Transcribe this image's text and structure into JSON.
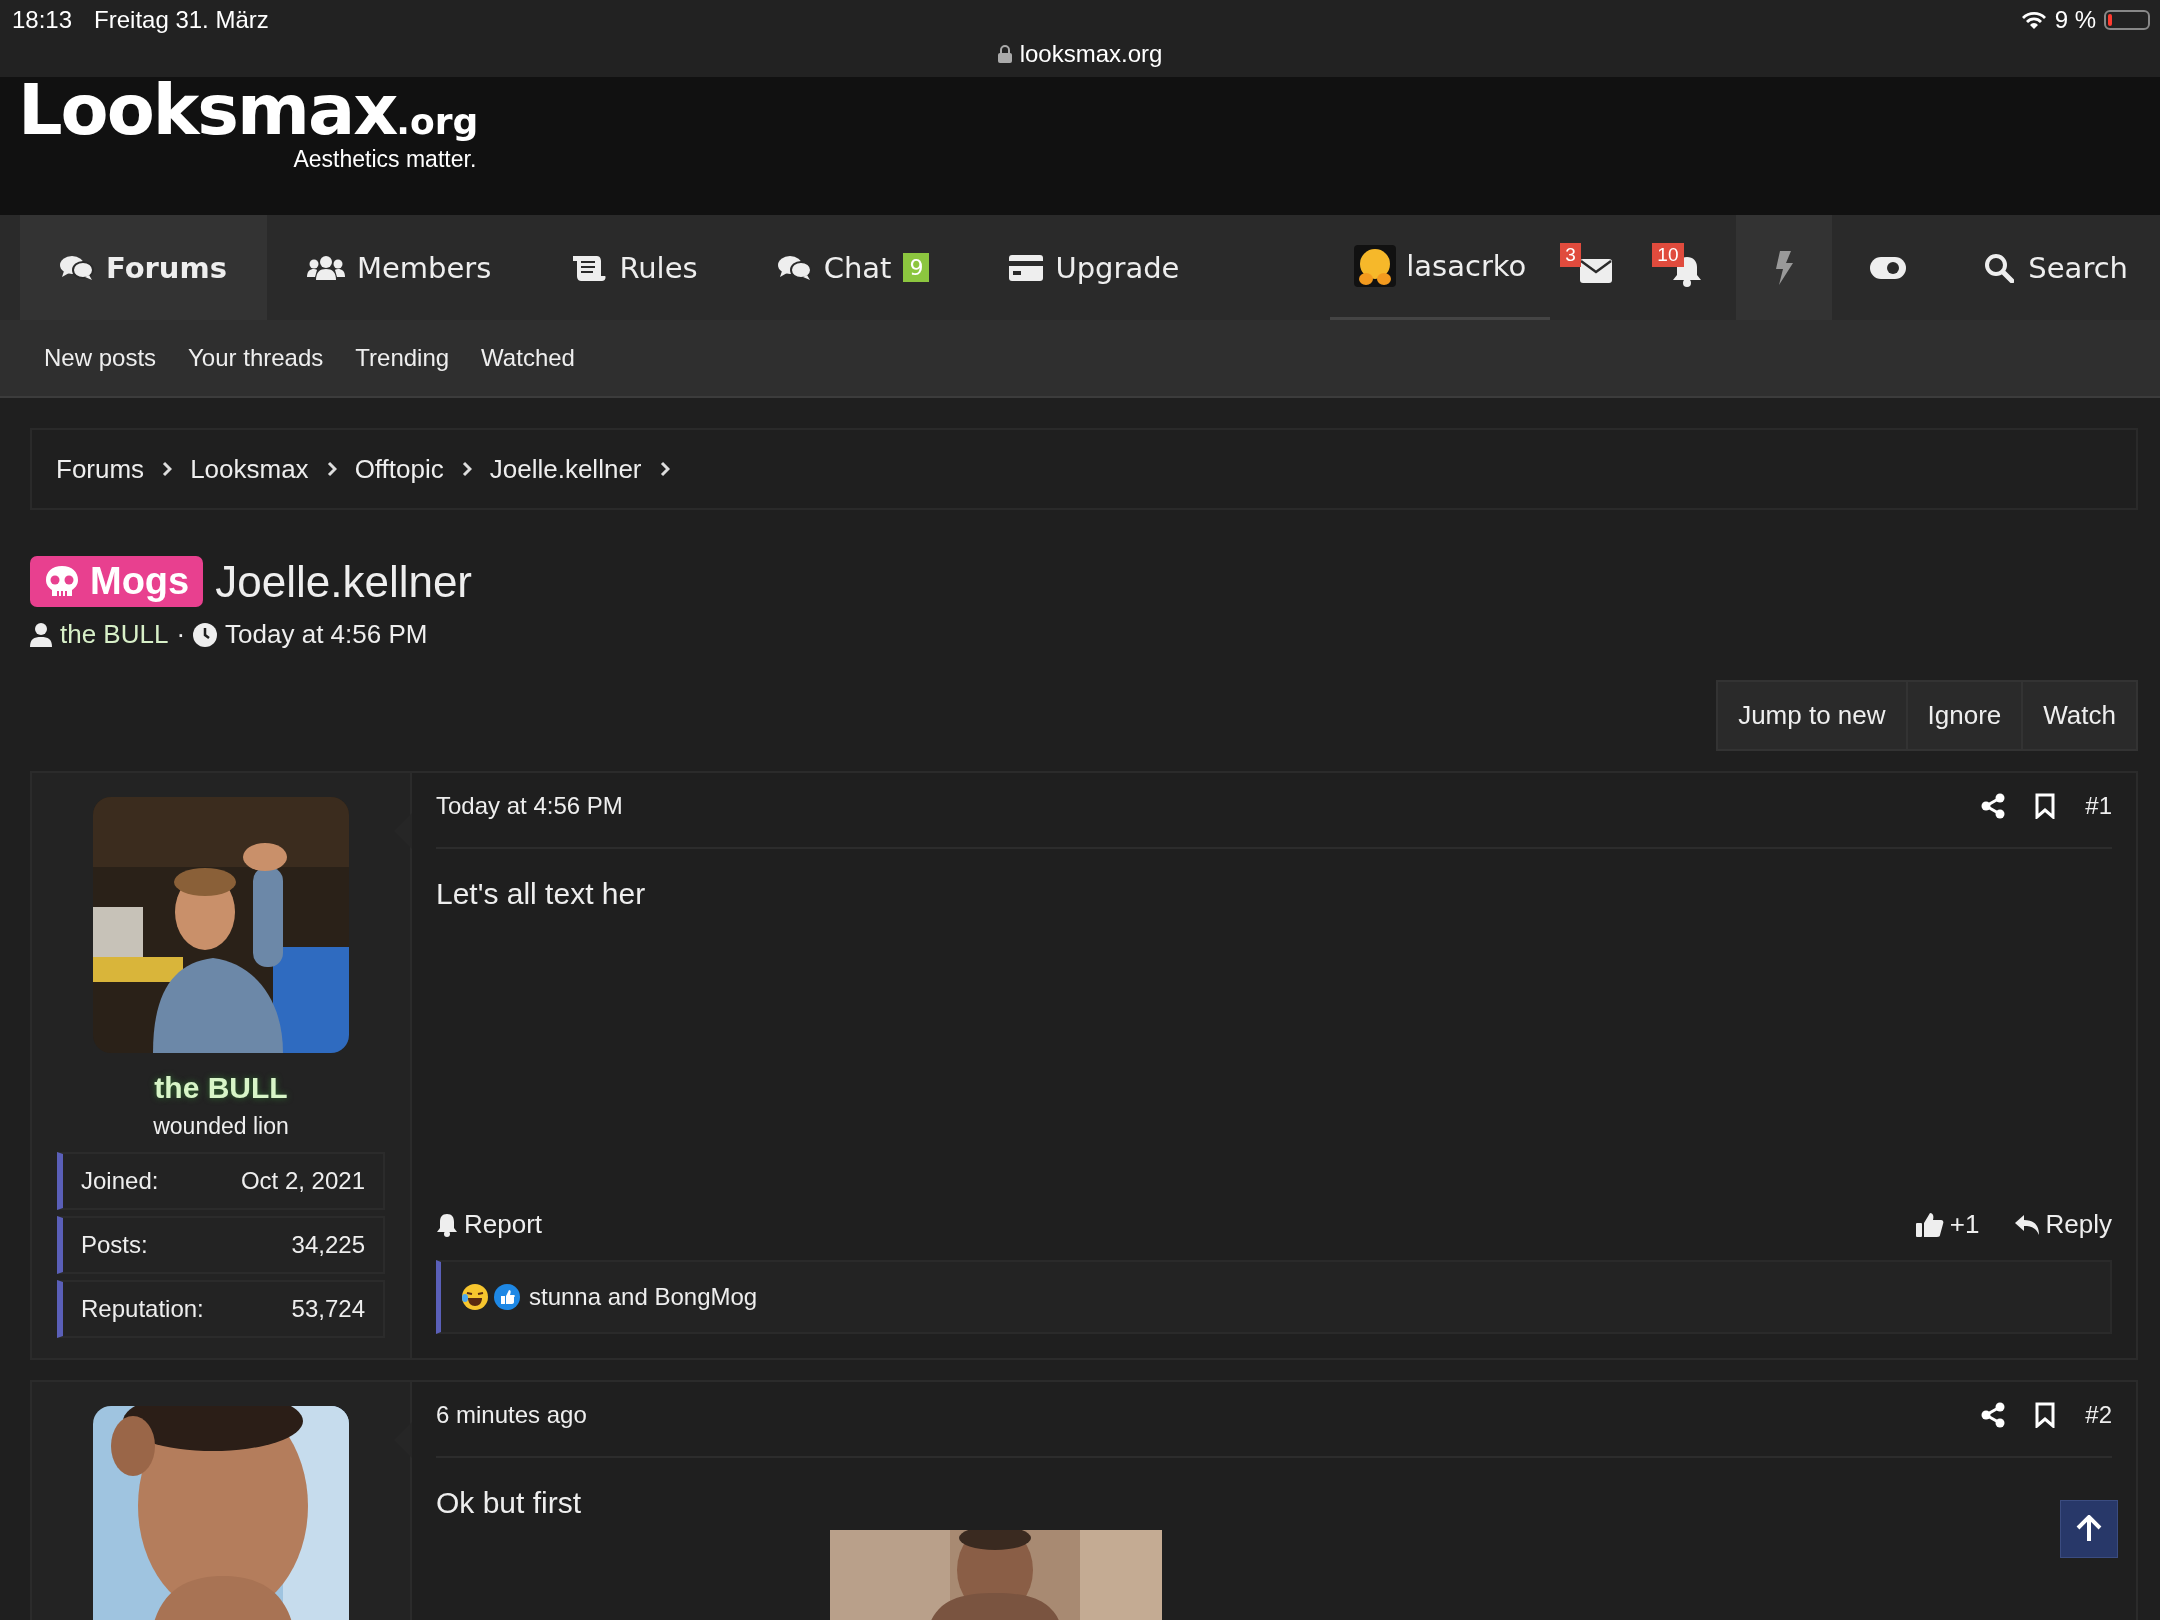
{
  "status_bar": {
    "time": "18:13",
    "date": "Freitag 31. März",
    "battery": "9 %"
  },
  "address_bar": {
    "url": "looksmax.org"
  },
  "header": {
    "logo": "Looksmax",
    "logo_suffix": ".org",
    "tagline": "Aesthetics matter."
  },
  "nav": {
    "tabs": [
      {
        "label": "Forums",
        "selected": true
      },
      {
        "label": "Members",
        "selected": false
      },
      {
        "label": "Rules",
        "selected": false
      },
      {
        "label": "Chat",
        "selected": false,
        "badge": "9"
      },
      {
        "label": "Upgrade",
        "selected": false
      }
    ],
    "user": "lasacrko",
    "messages_badge": "3",
    "alerts_badge": "10",
    "search": "Search"
  },
  "subnav": [
    "New posts",
    "Your threads",
    "Trending",
    "Watched"
  ],
  "breadcrumbs": [
    "Forums",
    "Looksmax",
    "Offtopic",
    "Joelle.kellner"
  ],
  "thread": {
    "prefix": "Mogs",
    "title": "Joelle.kellner",
    "author": "the BULL",
    "separator": "·",
    "date": "Today at 4:56 PM"
  },
  "thread_actions": [
    "Jump to new",
    "Ignore",
    "Watch"
  ],
  "posts": [
    {
      "user": "the BULL",
      "user_title": "wounded lion",
      "stats": [
        {
          "label": "Joined:",
          "value": "Oct 2, 2021"
        },
        {
          "label": "Posts:",
          "value": "34,225"
        },
        {
          "label": "Reputation:",
          "value": "53,724"
        }
      ],
      "date": "Today at 4:56 PM",
      "number": "#1",
      "body": "Let's all text her",
      "report": "Report",
      "likes": "+1",
      "reply": "Reply",
      "reactions": "stunna and BongMog"
    },
    {
      "date": "6 minutes ago",
      "number": "#2",
      "body": "Ok but first"
    }
  ]
}
